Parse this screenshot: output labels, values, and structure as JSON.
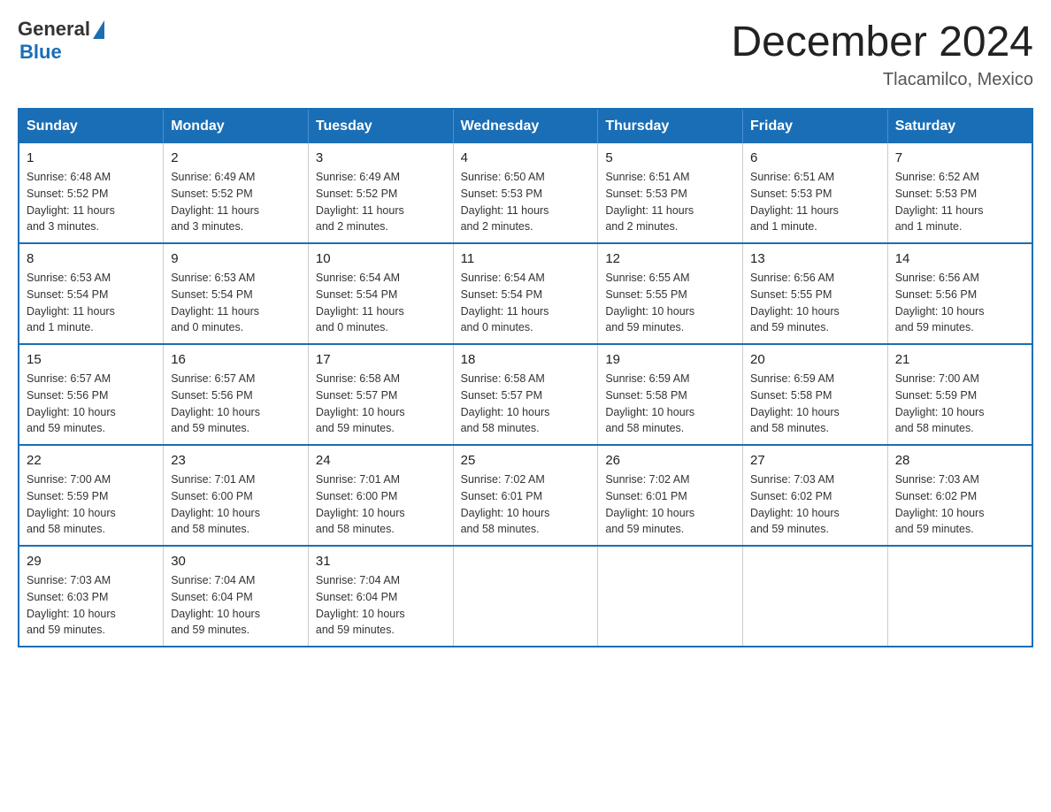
{
  "header": {
    "logo_text_general": "General",
    "logo_text_blue": "Blue",
    "main_title": "December 2024",
    "subtitle": "Tlacamilco, Mexico"
  },
  "calendar": {
    "days_of_week": [
      "Sunday",
      "Monday",
      "Tuesday",
      "Wednesday",
      "Thursday",
      "Friday",
      "Saturday"
    ],
    "weeks": [
      [
        {
          "num": "1",
          "info": "Sunrise: 6:48 AM\nSunset: 5:52 PM\nDaylight: 11 hours\nand 3 minutes."
        },
        {
          "num": "2",
          "info": "Sunrise: 6:49 AM\nSunset: 5:52 PM\nDaylight: 11 hours\nand 3 minutes."
        },
        {
          "num": "3",
          "info": "Sunrise: 6:49 AM\nSunset: 5:52 PM\nDaylight: 11 hours\nand 2 minutes."
        },
        {
          "num": "4",
          "info": "Sunrise: 6:50 AM\nSunset: 5:53 PM\nDaylight: 11 hours\nand 2 minutes."
        },
        {
          "num": "5",
          "info": "Sunrise: 6:51 AM\nSunset: 5:53 PM\nDaylight: 11 hours\nand 2 minutes."
        },
        {
          "num": "6",
          "info": "Sunrise: 6:51 AM\nSunset: 5:53 PM\nDaylight: 11 hours\nand 1 minute."
        },
        {
          "num": "7",
          "info": "Sunrise: 6:52 AM\nSunset: 5:53 PM\nDaylight: 11 hours\nand 1 minute."
        }
      ],
      [
        {
          "num": "8",
          "info": "Sunrise: 6:53 AM\nSunset: 5:54 PM\nDaylight: 11 hours\nand 1 minute."
        },
        {
          "num": "9",
          "info": "Sunrise: 6:53 AM\nSunset: 5:54 PM\nDaylight: 11 hours\nand 0 minutes."
        },
        {
          "num": "10",
          "info": "Sunrise: 6:54 AM\nSunset: 5:54 PM\nDaylight: 11 hours\nand 0 minutes."
        },
        {
          "num": "11",
          "info": "Sunrise: 6:54 AM\nSunset: 5:54 PM\nDaylight: 11 hours\nand 0 minutes."
        },
        {
          "num": "12",
          "info": "Sunrise: 6:55 AM\nSunset: 5:55 PM\nDaylight: 10 hours\nand 59 minutes."
        },
        {
          "num": "13",
          "info": "Sunrise: 6:56 AM\nSunset: 5:55 PM\nDaylight: 10 hours\nand 59 minutes."
        },
        {
          "num": "14",
          "info": "Sunrise: 6:56 AM\nSunset: 5:56 PM\nDaylight: 10 hours\nand 59 minutes."
        }
      ],
      [
        {
          "num": "15",
          "info": "Sunrise: 6:57 AM\nSunset: 5:56 PM\nDaylight: 10 hours\nand 59 minutes."
        },
        {
          "num": "16",
          "info": "Sunrise: 6:57 AM\nSunset: 5:56 PM\nDaylight: 10 hours\nand 59 minutes."
        },
        {
          "num": "17",
          "info": "Sunrise: 6:58 AM\nSunset: 5:57 PM\nDaylight: 10 hours\nand 59 minutes."
        },
        {
          "num": "18",
          "info": "Sunrise: 6:58 AM\nSunset: 5:57 PM\nDaylight: 10 hours\nand 58 minutes."
        },
        {
          "num": "19",
          "info": "Sunrise: 6:59 AM\nSunset: 5:58 PM\nDaylight: 10 hours\nand 58 minutes."
        },
        {
          "num": "20",
          "info": "Sunrise: 6:59 AM\nSunset: 5:58 PM\nDaylight: 10 hours\nand 58 minutes."
        },
        {
          "num": "21",
          "info": "Sunrise: 7:00 AM\nSunset: 5:59 PM\nDaylight: 10 hours\nand 58 minutes."
        }
      ],
      [
        {
          "num": "22",
          "info": "Sunrise: 7:00 AM\nSunset: 5:59 PM\nDaylight: 10 hours\nand 58 minutes."
        },
        {
          "num": "23",
          "info": "Sunrise: 7:01 AM\nSunset: 6:00 PM\nDaylight: 10 hours\nand 58 minutes."
        },
        {
          "num": "24",
          "info": "Sunrise: 7:01 AM\nSunset: 6:00 PM\nDaylight: 10 hours\nand 58 minutes."
        },
        {
          "num": "25",
          "info": "Sunrise: 7:02 AM\nSunset: 6:01 PM\nDaylight: 10 hours\nand 58 minutes."
        },
        {
          "num": "26",
          "info": "Sunrise: 7:02 AM\nSunset: 6:01 PM\nDaylight: 10 hours\nand 59 minutes."
        },
        {
          "num": "27",
          "info": "Sunrise: 7:03 AM\nSunset: 6:02 PM\nDaylight: 10 hours\nand 59 minutes."
        },
        {
          "num": "28",
          "info": "Sunrise: 7:03 AM\nSunset: 6:02 PM\nDaylight: 10 hours\nand 59 minutes."
        }
      ],
      [
        {
          "num": "29",
          "info": "Sunrise: 7:03 AM\nSunset: 6:03 PM\nDaylight: 10 hours\nand 59 minutes."
        },
        {
          "num": "30",
          "info": "Sunrise: 7:04 AM\nSunset: 6:04 PM\nDaylight: 10 hours\nand 59 minutes."
        },
        {
          "num": "31",
          "info": "Sunrise: 7:04 AM\nSunset: 6:04 PM\nDaylight: 10 hours\nand 59 minutes."
        },
        null,
        null,
        null,
        null
      ]
    ]
  }
}
